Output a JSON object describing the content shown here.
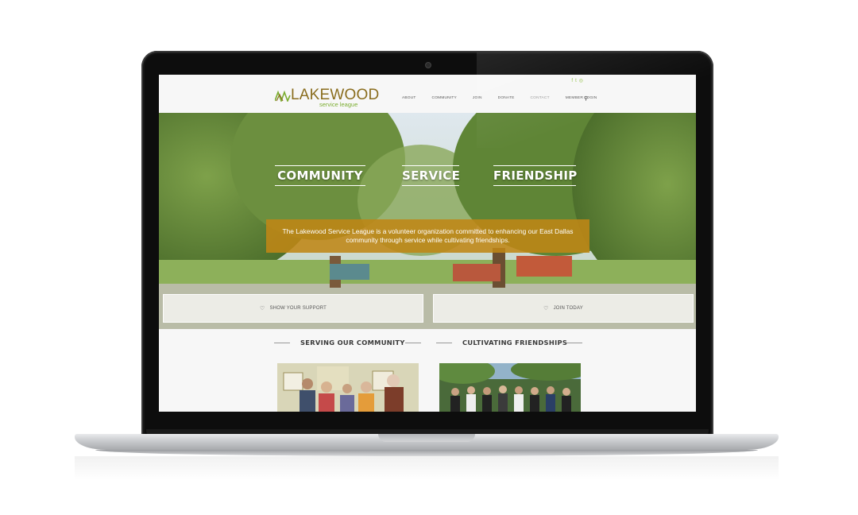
{
  "social": {
    "icons": [
      "facebook-icon",
      "twitter-icon",
      "instagram-icon"
    ],
    "glyphs": [
      "f",
      "t",
      "◎"
    ]
  },
  "logo": {
    "word": "LAKEWOOD",
    "sub": "service league"
  },
  "nav": {
    "items": [
      "ABOUT",
      "COMMUNITY",
      "JOIN",
      "DONATE",
      "CONTACT",
      "MEMBER LOGIN"
    ],
    "search_glyph": "⚲"
  },
  "hero": {
    "headings": [
      "COMMUNITY",
      "SERVICE",
      "FRIENDSHIP"
    ],
    "mission": "The Lakewood Service League is a volunteer organization committed to enhancing our East Dallas community through service while cultivating friendships.",
    "cta_support": "SHOW YOUR SUPPORT",
    "cta_join": "JOIN TODAY"
  },
  "sections": {
    "serving": "SERVING OUR COMMUNITY",
    "friendships": "CULTIVATING FRIENDSHIPS"
  },
  "colors": {
    "brand_gold": "#8a6d1e",
    "brand_green": "#7aad2f",
    "mission_bg": "#bf8616"
  }
}
